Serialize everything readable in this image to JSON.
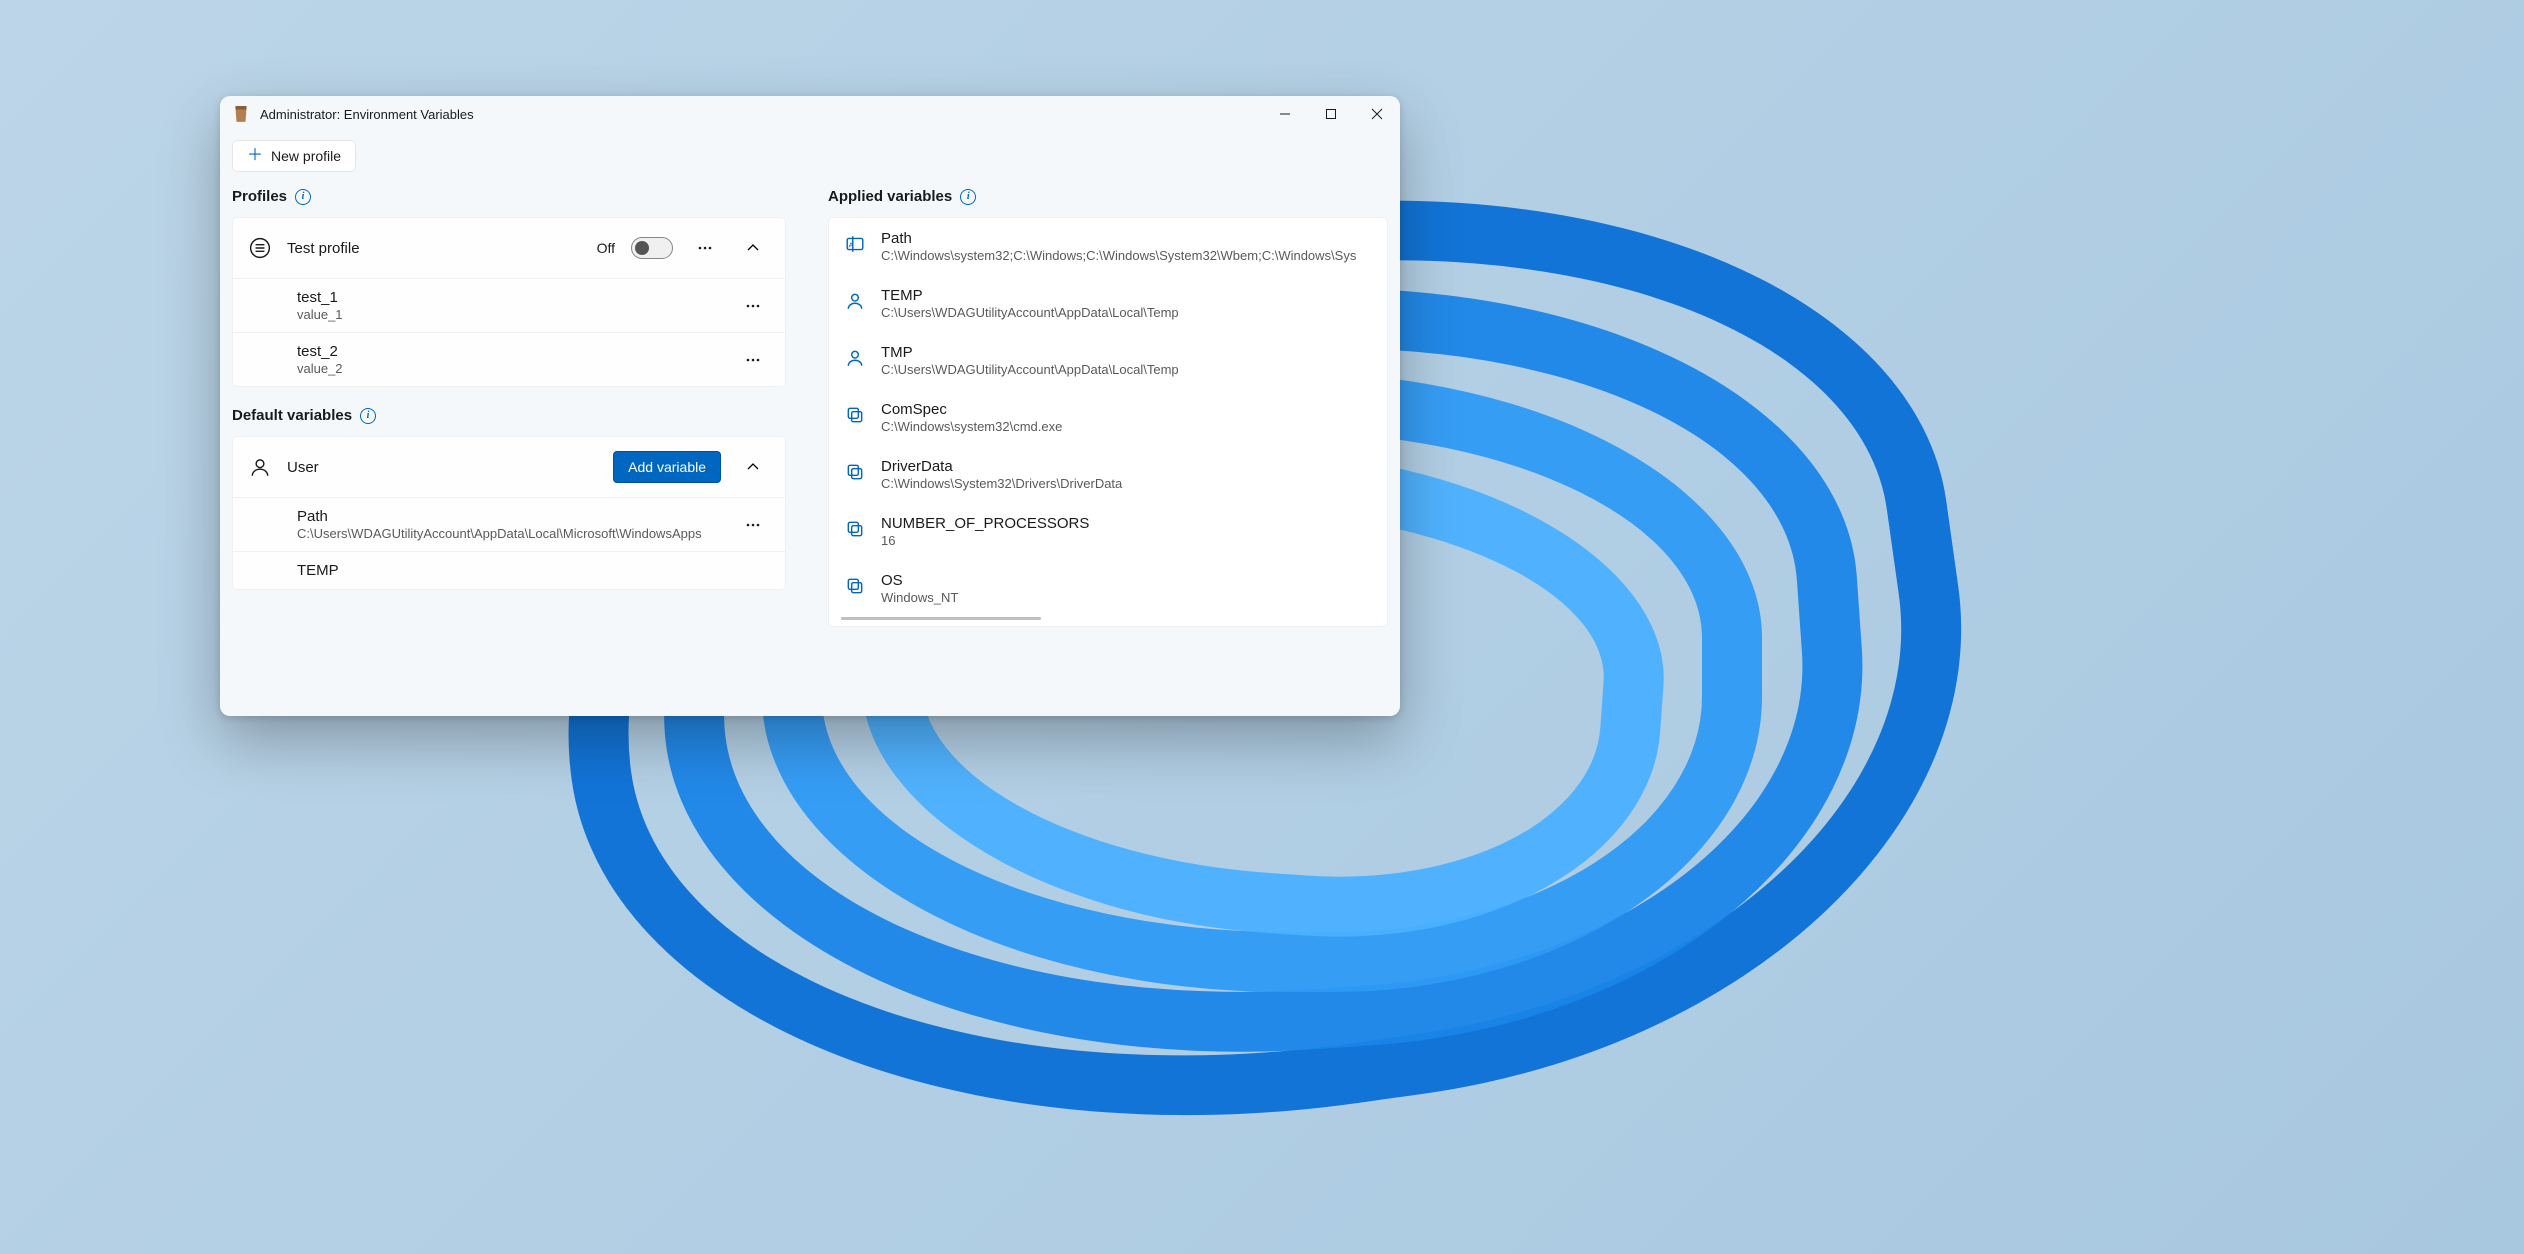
{
  "window": {
    "title": "Administrator: Environment Variables"
  },
  "toolbar": {
    "new_profile_label": "New profile"
  },
  "sections": {
    "profiles_label": "Profiles",
    "default_vars_label": "Default variables",
    "applied_label": "Applied variables"
  },
  "profiles": [
    {
      "name": "Test profile",
      "toggle_state": "Off",
      "variables": [
        {
          "name": "test_1",
          "value": "value_1"
        },
        {
          "name": "test_2",
          "value": "value_2"
        }
      ]
    }
  ],
  "default_groups": [
    {
      "name": "User",
      "add_label": "Add variable",
      "variables": [
        {
          "name": "Path",
          "value": "C:\\Users\\WDAGUtilityAccount\\AppData\\Local\\Microsoft\\WindowsApps"
        },
        {
          "name": "TEMP",
          "value": ""
        }
      ]
    }
  ],
  "applied": [
    {
      "icon": "rename",
      "name": "Path",
      "value": "C:\\Windows\\system32;C:\\Windows;C:\\Windows\\System32\\Wbem;C:\\Windows\\Sys"
    },
    {
      "icon": "user",
      "name": "TEMP",
      "value": "C:\\Users\\WDAGUtilityAccount\\AppData\\Local\\Temp"
    },
    {
      "icon": "user",
      "name": "TMP",
      "value": "C:\\Users\\WDAGUtilityAccount\\AppData\\Local\\Temp"
    },
    {
      "icon": "copy",
      "name": "ComSpec",
      "value": "C:\\Windows\\system32\\cmd.exe"
    },
    {
      "icon": "copy",
      "name": "DriverData",
      "value": "C:\\Windows\\System32\\Drivers\\DriverData"
    },
    {
      "icon": "copy",
      "name": "NUMBER_OF_PROCESSORS",
      "value": "16"
    },
    {
      "icon": "copy",
      "name": "OS",
      "value": "Windows_NT"
    }
  ]
}
